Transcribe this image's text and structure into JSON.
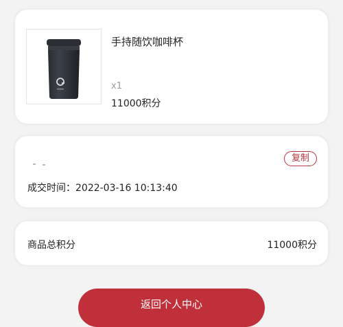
{
  "product": {
    "name": "手持随饮咖啡杯",
    "quantity": "x1",
    "points": "11000积分",
    "image": "black-coffee-tumbler"
  },
  "order": {
    "copy_label": "复制",
    "deal_time": "成交时间：2022-03-16 10:13:40"
  },
  "summary": {
    "label": "商品总积分",
    "value": "11000积分"
  },
  "footer": {
    "back_label": "返回个人中心"
  },
  "colors": {
    "accent": "#c0303a",
    "background": "#f3f3f3"
  }
}
